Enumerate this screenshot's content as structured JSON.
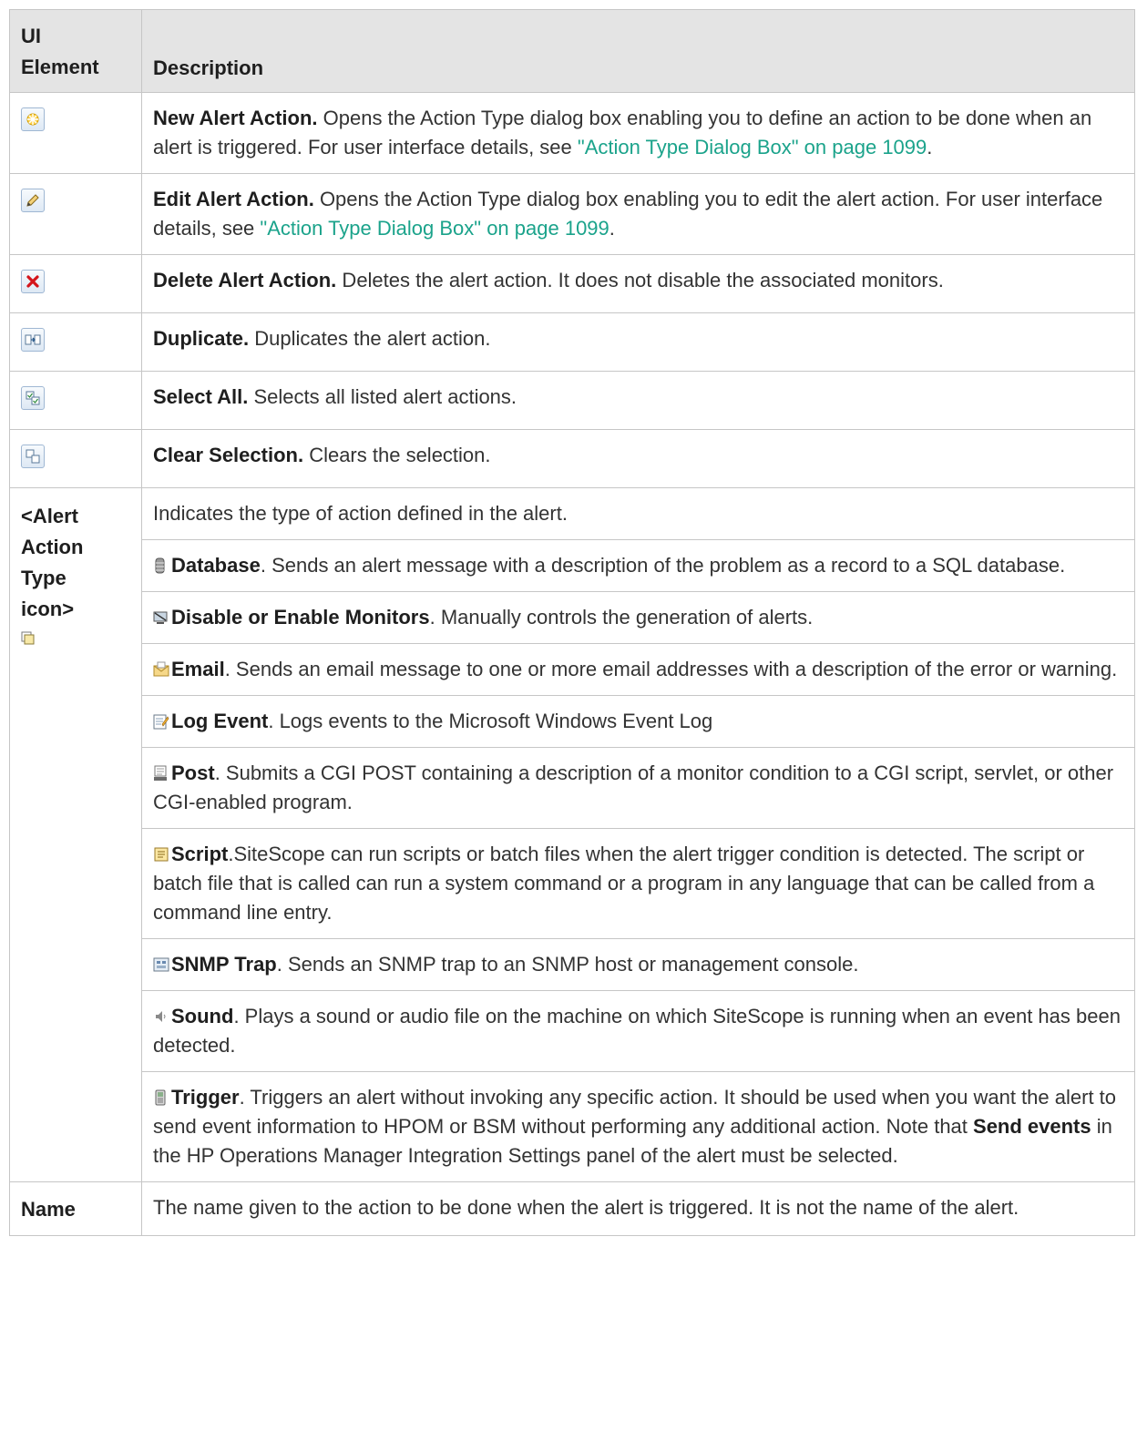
{
  "header": {
    "col1": "UI Element",
    "col1_line1": "UI",
    "col1_line2": "Element",
    "col2": "Description"
  },
  "toolbar_rows": [
    {
      "icon": "new-alert-action-icon",
      "bold": "New Alert Action.",
      "text": " Opens the Action Type dialog box enabling you to define an action to be done when an alert is triggered. For user interface details, see ",
      "link": "\"Action Type Dialog Box\" on page 1099",
      "after": "."
    },
    {
      "icon": "edit-alert-action-icon",
      "bold": "Edit Alert Action.",
      "text": " Opens the Action Type dialog box enabling you to edit the alert action. For user interface details, see ",
      "link": "\"Action Type Dialog Box\" on page 1099",
      "after": "."
    },
    {
      "icon": "delete-alert-action-icon",
      "bold": "Delete Alert Action.",
      "text": " Deletes the alert action. It does not disable the associated monitors."
    },
    {
      "icon": "duplicate-icon",
      "bold": "Duplicate.",
      "text": " Duplicates the alert action."
    },
    {
      "icon": "select-all-icon",
      "bold": "Select All.",
      "text": " Selects all listed alert actions."
    },
    {
      "icon": "clear-selection-icon",
      "bold": "Clear Selection.",
      "text": " Clears the selection."
    }
  ],
  "action_type": {
    "label_lines": [
      "<Alert",
      "Action",
      "Type",
      "icon>"
    ],
    "intro": "Indicates the type of action defined in the alert.",
    "types": [
      {
        "icon": "database-icon",
        "bold": "Database",
        "text": ". Sends an alert message with a description of the problem as a record to a SQL database."
      },
      {
        "icon": "disable-enable-monitors-icon",
        "bold": "Disable or Enable Monitors",
        "text": ". Manually controls the generation of alerts."
      },
      {
        "icon": "email-icon",
        "bold": "Email",
        "text": ". Sends an email message to one or more email addresses with a description of the error or warning."
      },
      {
        "icon": "log-event-icon",
        "bold": "Log Event",
        "text": ". Logs events to the Microsoft Windows Event Log"
      },
      {
        "icon": "post-icon",
        "bold": "Post",
        "text": ". Submits a CGI POST containing a description of a monitor condition to a CGI script, servlet, or other CGI-enabled program."
      },
      {
        "icon": "script-icon",
        "bold": "Script",
        "text": ".SiteScope can run scripts or batch files when the alert trigger condition is detected. The script or batch file that is called can run a system command or a program in any language that can be called from a command line entry."
      },
      {
        "icon": "snmp-trap-icon",
        "bold": "SNMP Trap",
        "text": ". Sends an SNMP trap to an SNMP host or management console."
      },
      {
        "icon": "sound-icon",
        "bold": "Sound",
        "text": ". Plays a sound or audio file on the machine on which SiteScope is running when an event has been detected."
      },
      {
        "icon": "trigger-icon",
        "bold": "Trigger",
        "text": ". Triggers an alert without invoking any specific action. It should be used when you want the alert to send event information to HPOM or BSM without performing any additional action. Note that ",
        "bold2": "Send events",
        "text2": " in the HP Operations Manager Integration Settings panel of the alert must be selected."
      }
    ]
  },
  "name_row": {
    "label": "Name",
    "text": "The name given to the action to be done when the alert is triggered. It is not the name of the alert."
  }
}
